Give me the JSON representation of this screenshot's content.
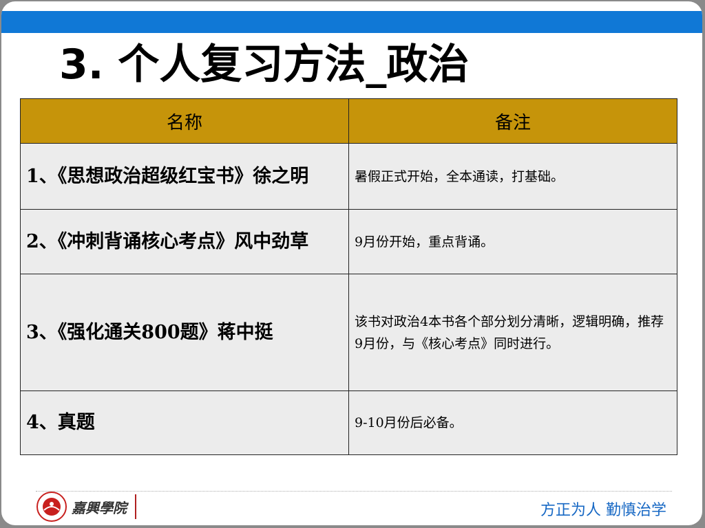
{
  "title": "3. 个人复习方法_政治",
  "table": {
    "headers": [
      "名称",
      "备注"
    ],
    "rows": [
      {
        "name": "1、《思想政治超级红宝书》徐之明",
        "note": "暑假正式开始，全本通读，打基础。"
      },
      {
        "name": "2、《冲刺背诵核心考点》风中劲草",
        "note": "9月份开始，重点背诵。"
      },
      {
        "name": "3、《强化通关800题》蒋中挺",
        "note": "该书对政治4本书各个部分划分清晰，逻辑明确，推荐9月份，与《核心考点》同时进行。"
      },
      {
        "name": "4、真题",
        "note": "9-10月份后必备。"
      }
    ]
  },
  "footer": {
    "school_name": "嘉興學院",
    "motto": "方正为人  勤慎治学"
  },
  "colors": {
    "top_bar": "#1078d6",
    "header_fill": "#c6940a",
    "cell_fill": "#ececec",
    "motto": "#1768c4",
    "seal": "#c8201e"
  }
}
